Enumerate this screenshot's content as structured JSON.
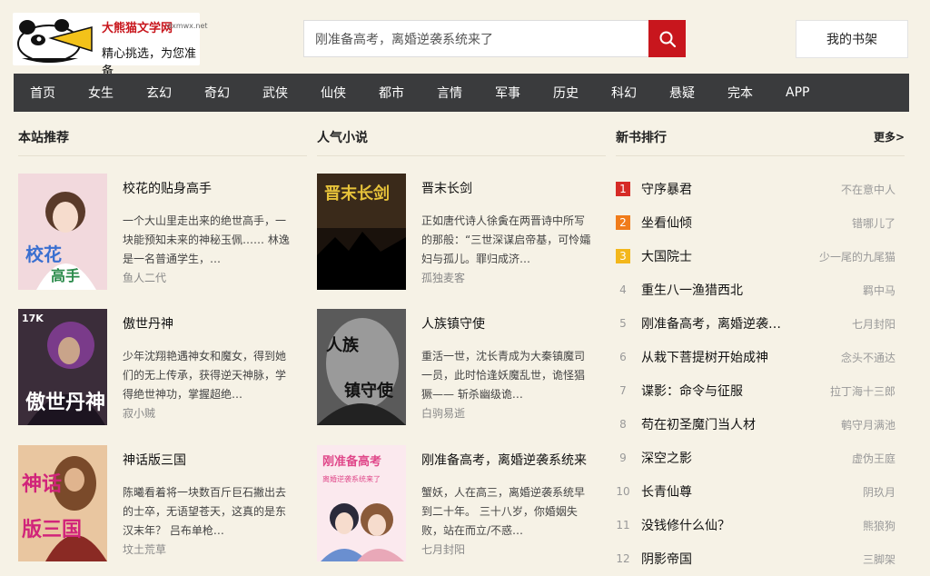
{
  "header": {
    "logo_title": "大熊猫文学网",
    "logo_domain": "dxmwx.net",
    "logo_slogan": "精心挑选，为您准备",
    "search_value": "刚准备高考，离婚逆袭系统来了",
    "shelf_label": "我的书架"
  },
  "nav": [
    "首页",
    "女生",
    "玄幻",
    "奇幻",
    "武侠",
    "仙侠",
    "都市",
    "言情",
    "军事",
    "历史",
    "科幻",
    "悬疑",
    "完本",
    "APP"
  ],
  "recommend": {
    "heading": "本站推荐",
    "books": [
      {
        "name": "校花的贴身高手",
        "desc": "一个大山里走出来的绝世高手，一块能预知未来的神秘玉佩…… 林逸是一名普通学生，…",
        "author": "鱼人二代"
      },
      {
        "name": "傲世丹神",
        "desc": "少年沈翔艳遇神女和魔女，得到她们的无上传承，获得逆天神脉，学得绝世神功，掌握超绝…",
        "author": "寂小贼"
      },
      {
        "name": "神话版三国",
        "desc": "陈曦看着将一块数百斤巨石撇出去的士卒，无语望苍天，这真的是东汉末年？ 吕布单枪…",
        "author": "坟土荒草"
      }
    ]
  },
  "popular": {
    "heading": "人气小说",
    "books": [
      {
        "name": "晋末长剑",
        "desc": "正如唐代诗人徐夤在两晋诗中所写的那般：“三世深谋启帝基，可怜孀妇与孤儿。罪归成济…",
        "author": "孤独麦客"
      },
      {
        "name": "人族镇守使",
        "desc": "重活一世，沈长青成为大秦镇魔司一员，此时恰逢妖魔乱世，诡怪猖獗—— 斩杀幽级诡…",
        "author": "白驹易逝"
      },
      {
        "name": "刚准备高考，离婚逆袭系统来",
        "desc": "蟹妖，人在高三，离婚逆袭系统早到二十年。 三十八岁，你婚姻失败，站在而立/不惑…",
        "author": "七月封阳"
      }
    ]
  },
  "ranking": {
    "heading": "新书排行",
    "more": "更多>",
    "items": [
      {
        "num": "1",
        "name": "守序暴君",
        "author": "不在意中人"
      },
      {
        "num": "2",
        "name": "坐看仙倾",
        "author": "错哪儿了"
      },
      {
        "num": "3",
        "name": "大国院士",
        "author": "少一尾的九尾猫"
      },
      {
        "num": "4",
        "name": "重生八一渔猎西北",
        "author": "羁中马"
      },
      {
        "num": "5",
        "name": "刚准备高考，离婚逆袭…",
        "author": "七月封阳"
      },
      {
        "num": "6",
        "name": "从栽下菩提树开始成神",
        "author": "念头不通达"
      },
      {
        "num": "7",
        "name": "谍影：命令与征服",
        "author": "拉丁海十三郎"
      },
      {
        "num": "8",
        "name": "苟在初圣魔门当人材",
        "author": "鹌守月满池"
      },
      {
        "num": "9",
        "name": "深空之影",
        "author": "虚伪王庭"
      },
      {
        "num": "10",
        "name": "长青仙尊",
        "author": "阴玖月"
      },
      {
        "num": "11",
        "name": "没钱修什么仙？",
        "author": "熊狼狗"
      },
      {
        "num": "12",
        "name": "阴影帝国",
        "author": "三脚架"
      }
    ]
  },
  "colors": {
    "accent": "#c8161d",
    "nav_bg": "#3a3b3d",
    "page_bg": "#f6f2e6",
    "rank1": "#d62b26",
    "rank2": "#f07c1b",
    "rank3": "#f3b71b"
  }
}
